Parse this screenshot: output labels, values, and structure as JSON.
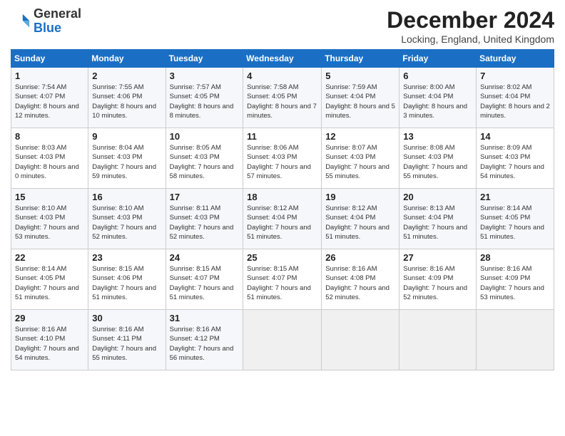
{
  "logo": {
    "general": "General",
    "blue": "Blue"
  },
  "header": {
    "month_year": "December 2024",
    "location": "Locking, England, United Kingdom"
  },
  "weekdays": [
    "Sunday",
    "Monday",
    "Tuesday",
    "Wednesday",
    "Thursday",
    "Friday",
    "Saturday"
  ],
  "weeks": [
    [
      {
        "day": "1",
        "sunrise": "Sunrise: 7:54 AM",
        "sunset": "Sunset: 4:07 PM",
        "daylight": "Daylight: 8 hours and 12 minutes."
      },
      {
        "day": "2",
        "sunrise": "Sunrise: 7:55 AM",
        "sunset": "Sunset: 4:06 PM",
        "daylight": "Daylight: 8 hours and 10 minutes."
      },
      {
        "day": "3",
        "sunrise": "Sunrise: 7:57 AM",
        "sunset": "Sunset: 4:05 PM",
        "daylight": "Daylight: 8 hours and 8 minutes."
      },
      {
        "day": "4",
        "sunrise": "Sunrise: 7:58 AM",
        "sunset": "Sunset: 4:05 PM",
        "daylight": "Daylight: 8 hours and 7 minutes."
      },
      {
        "day": "5",
        "sunrise": "Sunrise: 7:59 AM",
        "sunset": "Sunset: 4:04 PM",
        "daylight": "Daylight: 8 hours and 5 minutes."
      },
      {
        "day": "6",
        "sunrise": "Sunrise: 8:00 AM",
        "sunset": "Sunset: 4:04 PM",
        "daylight": "Daylight: 8 hours and 3 minutes."
      },
      {
        "day": "7",
        "sunrise": "Sunrise: 8:02 AM",
        "sunset": "Sunset: 4:04 PM",
        "daylight": "Daylight: 8 hours and 2 minutes."
      }
    ],
    [
      {
        "day": "8",
        "sunrise": "Sunrise: 8:03 AM",
        "sunset": "Sunset: 4:03 PM",
        "daylight": "Daylight: 8 hours and 0 minutes."
      },
      {
        "day": "9",
        "sunrise": "Sunrise: 8:04 AM",
        "sunset": "Sunset: 4:03 PM",
        "daylight": "Daylight: 7 hours and 59 minutes."
      },
      {
        "day": "10",
        "sunrise": "Sunrise: 8:05 AM",
        "sunset": "Sunset: 4:03 PM",
        "daylight": "Daylight: 7 hours and 58 minutes."
      },
      {
        "day": "11",
        "sunrise": "Sunrise: 8:06 AM",
        "sunset": "Sunset: 4:03 PM",
        "daylight": "Daylight: 7 hours and 57 minutes."
      },
      {
        "day": "12",
        "sunrise": "Sunrise: 8:07 AM",
        "sunset": "Sunset: 4:03 PM",
        "daylight": "Daylight: 7 hours and 55 minutes."
      },
      {
        "day": "13",
        "sunrise": "Sunrise: 8:08 AM",
        "sunset": "Sunset: 4:03 PM",
        "daylight": "Daylight: 7 hours and 55 minutes."
      },
      {
        "day": "14",
        "sunrise": "Sunrise: 8:09 AM",
        "sunset": "Sunset: 4:03 PM",
        "daylight": "Daylight: 7 hours and 54 minutes."
      }
    ],
    [
      {
        "day": "15",
        "sunrise": "Sunrise: 8:10 AM",
        "sunset": "Sunset: 4:03 PM",
        "daylight": "Daylight: 7 hours and 53 minutes."
      },
      {
        "day": "16",
        "sunrise": "Sunrise: 8:10 AM",
        "sunset": "Sunset: 4:03 PM",
        "daylight": "Daylight: 7 hours and 52 minutes."
      },
      {
        "day": "17",
        "sunrise": "Sunrise: 8:11 AM",
        "sunset": "Sunset: 4:03 PM",
        "daylight": "Daylight: 7 hours and 52 minutes."
      },
      {
        "day": "18",
        "sunrise": "Sunrise: 8:12 AM",
        "sunset": "Sunset: 4:04 PM",
        "daylight": "Daylight: 7 hours and 51 minutes."
      },
      {
        "day": "19",
        "sunrise": "Sunrise: 8:12 AM",
        "sunset": "Sunset: 4:04 PM",
        "daylight": "Daylight: 7 hours and 51 minutes."
      },
      {
        "day": "20",
        "sunrise": "Sunrise: 8:13 AM",
        "sunset": "Sunset: 4:04 PM",
        "daylight": "Daylight: 7 hours and 51 minutes."
      },
      {
        "day": "21",
        "sunrise": "Sunrise: 8:14 AM",
        "sunset": "Sunset: 4:05 PM",
        "daylight": "Daylight: 7 hours and 51 minutes."
      }
    ],
    [
      {
        "day": "22",
        "sunrise": "Sunrise: 8:14 AM",
        "sunset": "Sunset: 4:05 PM",
        "daylight": "Daylight: 7 hours and 51 minutes."
      },
      {
        "day": "23",
        "sunrise": "Sunrise: 8:15 AM",
        "sunset": "Sunset: 4:06 PM",
        "daylight": "Daylight: 7 hours and 51 minutes."
      },
      {
        "day": "24",
        "sunrise": "Sunrise: 8:15 AM",
        "sunset": "Sunset: 4:07 PM",
        "daylight": "Daylight: 7 hours and 51 minutes."
      },
      {
        "day": "25",
        "sunrise": "Sunrise: 8:15 AM",
        "sunset": "Sunset: 4:07 PM",
        "daylight": "Daylight: 7 hours and 51 minutes."
      },
      {
        "day": "26",
        "sunrise": "Sunrise: 8:16 AM",
        "sunset": "Sunset: 4:08 PM",
        "daylight": "Daylight: 7 hours and 52 minutes."
      },
      {
        "day": "27",
        "sunrise": "Sunrise: 8:16 AM",
        "sunset": "Sunset: 4:09 PM",
        "daylight": "Daylight: 7 hours and 52 minutes."
      },
      {
        "day": "28",
        "sunrise": "Sunrise: 8:16 AM",
        "sunset": "Sunset: 4:09 PM",
        "daylight": "Daylight: 7 hours and 53 minutes."
      }
    ],
    [
      {
        "day": "29",
        "sunrise": "Sunrise: 8:16 AM",
        "sunset": "Sunset: 4:10 PM",
        "daylight": "Daylight: 7 hours and 54 minutes."
      },
      {
        "day": "30",
        "sunrise": "Sunrise: 8:16 AM",
        "sunset": "Sunset: 4:11 PM",
        "daylight": "Daylight: 7 hours and 55 minutes."
      },
      {
        "day": "31",
        "sunrise": "Sunrise: 8:16 AM",
        "sunset": "Sunset: 4:12 PM",
        "daylight": "Daylight: 7 hours and 56 minutes."
      },
      null,
      null,
      null,
      null
    ]
  ]
}
